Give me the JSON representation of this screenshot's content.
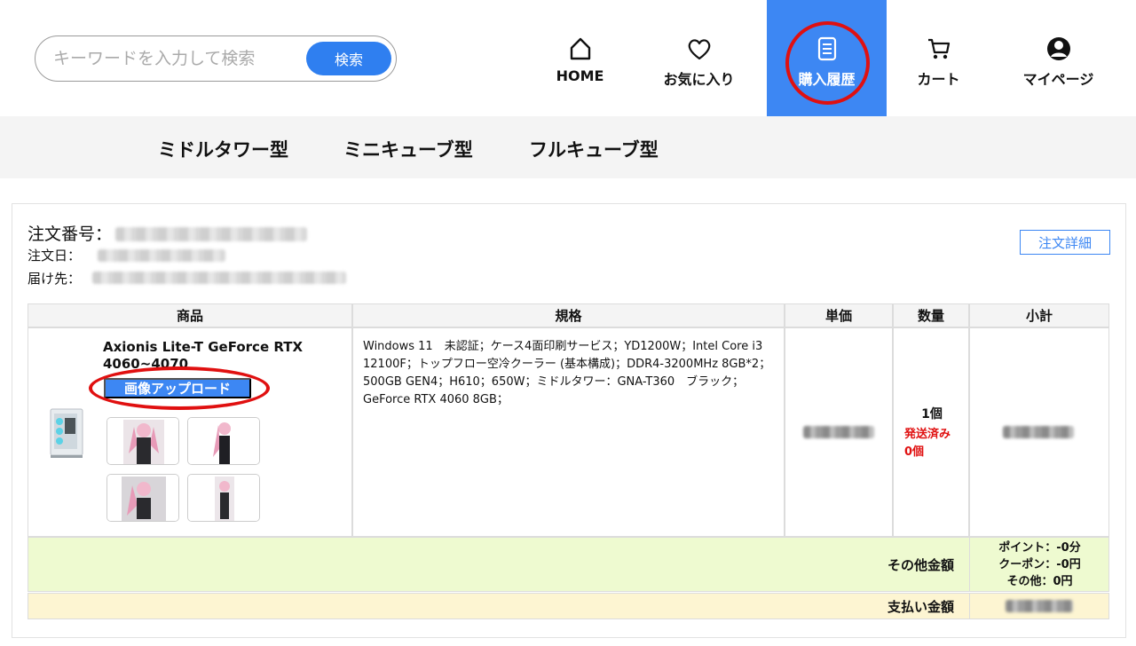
{
  "search": {
    "placeholder": "キーワードを入力して検索",
    "button_label": "検索"
  },
  "nav": [
    {
      "label": "HOME",
      "icon": "home-icon"
    },
    {
      "label": "お気に入り",
      "icon": "heart-icon"
    },
    {
      "label": "購入履歴",
      "icon": "document-icon",
      "active": true
    },
    {
      "label": "カート",
      "icon": "cart-icon"
    },
    {
      "label": "マイページ",
      "icon": "user-icon"
    }
  ],
  "categories": [
    "ミドルタワー型",
    "ミニキューブ型",
    "フルキューブ型"
  ],
  "order": {
    "number_label": "注文番号：",
    "date_label": "注文日：",
    "address_label": "届け先：",
    "detail_button": "注文詳細"
  },
  "table": {
    "headers": [
      "商品",
      "規格",
      "単価",
      "数量",
      "小計"
    ],
    "item": {
      "name": "Axionis Lite-T GeForce RTX 4060~4070",
      "upload_button": "画像アップロード",
      "spec": "Windows 11　未認証；ケース4面印刷サービス；YD1200W；Intel Core i3 12100F；トップフロー空冷クーラー (基本構成)；DDR4-3200MHz 8GB*2；500GB GEN4；H610；650W；ミドルタワー：GNA-T360　ブラック；GeForce RTX 4060 8GB；",
      "quantity": "1個",
      "shipped_label": "発送済み",
      "shipped_count": "0個"
    },
    "other_label": "その他金額",
    "points": "ポイント：-0分",
    "coupon": "クーポン：-0円",
    "other": "その他：0円",
    "pay_label": "支払い金額"
  },
  "colors": {
    "accent": "#3d87f3",
    "highlight": "#e01010",
    "other_row": "#eefad0",
    "pay_row": "#fdf5d2"
  }
}
